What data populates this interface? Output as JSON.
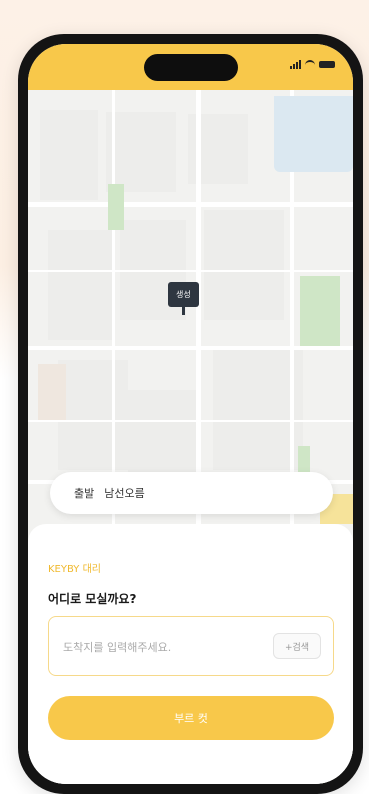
{
  "colors": {
    "accent": "#f8c84a",
    "accent_text": "#f0b92e",
    "pin": "#2e3640",
    "park": "#cfe6c6",
    "water": "#dbe8f1"
  },
  "status_bar": {
    "icons": [
      "signal-icon",
      "wifi-icon",
      "battery-icon"
    ]
  },
  "map": {
    "pin_label": "생성"
  },
  "destination": {
    "label": "출발",
    "value": "남선오름"
  },
  "sheet": {
    "title": "KEYBY 대리",
    "question": "어디로 모실까요?",
    "address_placeholder": "도착지를 입력해주세요.",
    "zip_button": "+검색",
    "primary_button": "부르 컷"
  }
}
